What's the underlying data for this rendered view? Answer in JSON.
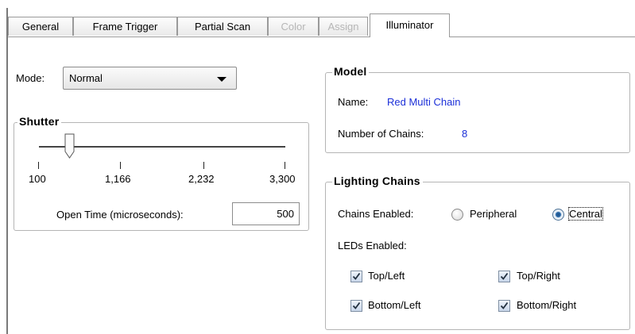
{
  "tabs": [
    {
      "label": "General",
      "state": "normal"
    },
    {
      "label": "Frame Trigger",
      "state": "normal"
    },
    {
      "label": "Partial Scan",
      "state": "normal"
    },
    {
      "label": "Color",
      "state": "disabled"
    },
    {
      "label": "Assign",
      "state": "disabled"
    },
    {
      "label": "Illuminator",
      "state": "active"
    }
  ],
  "mode": {
    "label": "Mode:",
    "selected": "Normal"
  },
  "shutter": {
    "title": "Shutter",
    "slider_value": 500,
    "slider_min": 100,
    "slider_max": 3300,
    "ticks": [
      "100",
      "1,166",
      "2,232",
      "3,300"
    ],
    "open_time_label": "Open Time (microseconds):",
    "open_time_value": "500"
  },
  "model": {
    "title": "Model",
    "name_label": "Name:",
    "name_value": "Red Multi Chain",
    "chains_label": "Number of Chains:",
    "chains_value": "8"
  },
  "lighting": {
    "title": "Lighting Chains",
    "chains_enabled_label": "Chains Enabled:",
    "radio_peripheral": {
      "label": "Peripheral",
      "checked": false
    },
    "radio_central": {
      "label": "Central",
      "checked": true
    },
    "leds_label": "LEDs Enabled:",
    "leds": {
      "top_left": {
        "label": "Top/Left",
        "checked": true
      },
      "top_right": {
        "label": "Top/Right",
        "checked": true
      },
      "bottom_left": {
        "label": "Bottom/Left",
        "checked": true
      },
      "bottom_right": {
        "label": "Bottom/Right",
        "checked": true
      }
    }
  },
  "colors": {
    "value_blue": "#1b2fd8",
    "radio_selected": "#2b6aa9"
  }
}
